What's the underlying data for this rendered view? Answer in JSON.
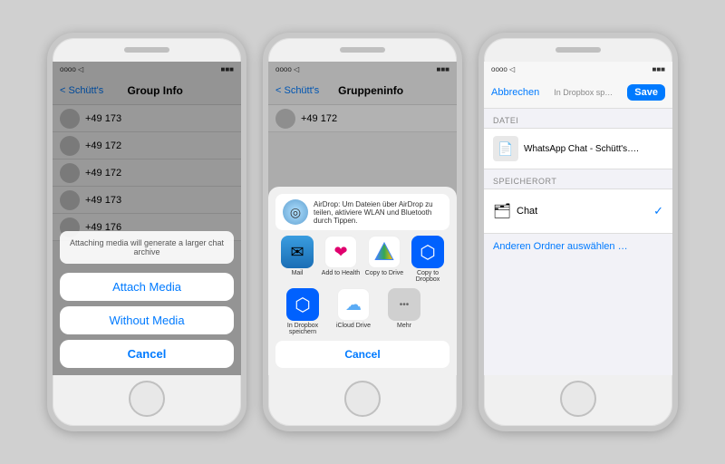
{
  "phone1": {
    "statusbar": {
      "carrier": "oooo ◁",
      "wifi": "WiFi",
      "battery": "■■■"
    },
    "nav": {
      "back_label": "< Schütt's",
      "title": "Group Info"
    },
    "contacts": [
      {
        "name": "+49 173"
      },
      {
        "name": "+49 172"
      },
      {
        "name": "+49 172"
      },
      {
        "name": "+49 173"
      },
      {
        "name": "+49 176"
      }
    ],
    "dialog": {
      "message": "Attaching media will generate a larger chat archive",
      "attach_label": "Attach Media",
      "without_label": "Without Media",
      "cancel_label": "Cancel"
    }
  },
  "phone2": {
    "statusbar": {
      "carrier": "oooo ◁",
      "wifi": "WiFi"
    },
    "nav": {
      "back_label": "< Schütt's",
      "title": "Gruppeninfo"
    },
    "contacts": [
      {
        "name": "+49 172"
      }
    ],
    "airdrop": {
      "icon": "◎",
      "text": "AirDrop: Um Dateien über AirDrop zu teilen, aktiviere WLAN und Bluetooth durch Tippen."
    },
    "apps_row1": [
      {
        "icon": "✉",
        "class": "mail",
        "label": "Mail"
      },
      {
        "icon": "❤",
        "class": "health",
        "label": "Add to Health"
      },
      {
        "icon": "▲",
        "class": "drive",
        "label": "Copy to Drive"
      },
      {
        "icon": "⬡",
        "class": "dropbox",
        "label": "Copy to Dropbox"
      }
    ],
    "apps_row2": [
      {
        "icon": "⬡",
        "class": "dropbox2",
        "label": "In Dropbox speichern"
      },
      {
        "icon": "☁",
        "class": "icloud",
        "label": "iCloud Drive"
      },
      {
        "icon": "•••",
        "class": "mehr",
        "label": "Mehr"
      }
    ],
    "cancel_label": "Cancel"
  },
  "phone3": {
    "statusbar": {
      "carrier": "oooo ◁",
      "wifi": "WiFi"
    },
    "nav": {
      "cancel_label": "Abbrechen",
      "title": "In Dropbox sp…",
      "save_label": "Save"
    },
    "section_file": "DATEI",
    "file_name": "WhatsApp Chat - Schütt's….",
    "section_location": "SPEICHERORT",
    "location_item": {
      "name": "Chat"
    },
    "other_label": "Anderen Ordner auswählen …"
  }
}
